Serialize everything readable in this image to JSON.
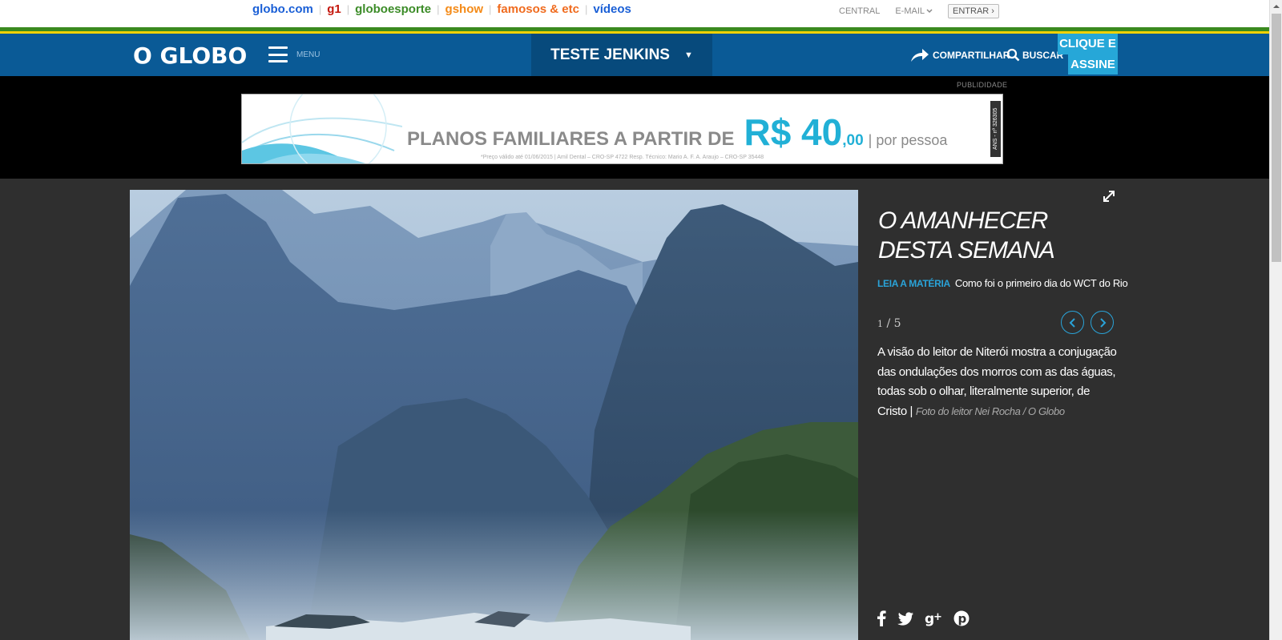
{
  "global_bar": {
    "links": [
      {
        "label": "globo.com",
        "color": "#1a5fd6"
      },
      {
        "label": "g1",
        "color": "#c4170c"
      },
      {
        "label": "globoesporte",
        "color": "#3c8c28"
      },
      {
        "label": "gshow",
        "color": "#f48a17"
      },
      {
        "label": "famosos & etc",
        "color": "#f06b1e"
      },
      {
        "label": "vídeos",
        "color": "#1a5fd6"
      }
    ],
    "central": "CENTRAL",
    "email": "E-MAIL",
    "entrar": "ENTRAR ›"
  },
  "header": {
    "logo": "O GLOBO",
    "menu": "MENU",
    "section": "TESTE JENKINS",
    "share": "COMPARTILHAR",
    "search": "BUSCAR",
    "assine_line1": "CLIQUE E",
    "assine_line2": "ASSINE"
  },
  "ad": {
    "label": "PUBLIDIDADE",
    "headline": "PLANOS FAMILIARES A PARTIR DE",
    "price": "R$ 40",
    "cents": ",00",
    "per": "| por pessoa",
    "fine_print": "*Preço válido até 01/06/2015 | Amil Dental – CRO-SP 4722 Resp. Técnico: Mario A. F. A. Araujo – CRO-SP 35448",
    "ans": "ANS - nº 326305"
  },
  "gallery": {
    "title": "O AMANHECER DESTA SEMANA",
    "leia_label": "LEIA A MATÉRIA",
    "leia_title": "Como foi o primeiro dia do WCT do Rio",
    "current": "1",
    "total": "/ 5",
    "caption": "A visão do leitor de Niterói mostra a conjugação das ondulações dos morros com as das águas, todas sob o olhar, literalmente superior, de Cristo |",
    "credit": "Foto do leitor Nei Rocha / O Globo"
  },
  "colors": {
    "header_blue": "#0a5a96",
    "accent_blue": "#2aa3d8",
    "background": "#2f2f2f"
  }
}
